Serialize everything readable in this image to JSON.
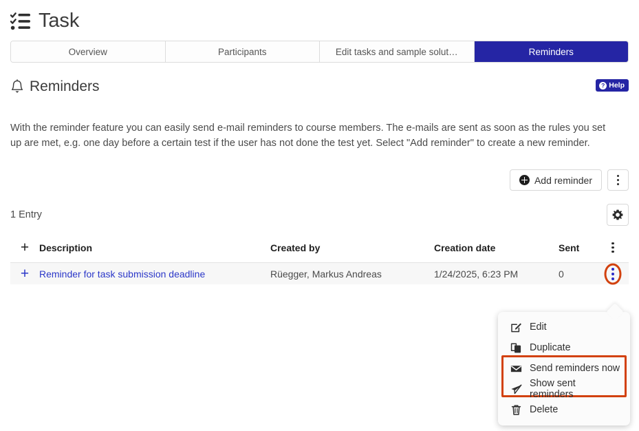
{
  "header": {
    "title": "Task",
    "icon": "checklist-icon"
  },
  "tabs": [
    {
      "label": "Overview",
      "active": false
    },
    {
      "label": "Participants",
      "active": false
    },
    {
      "label": "Edit tasks and sample solut…",
      "active": false
    },
    {
      "label": "Reminders",
      "active": true
    }
  ],
  "section": {
    "title": "Reminders",
    "icon": "bell-icon",
    "help_label": "Help",
    "help_icon": "question-circle-icon",
    "description": "With the reminder feature you can easily send e-mail reminders to course members. The e-mails are sent as soon as the rules you set up are met, e.g. one day before a certain test if the user has not done the test yet. Select \"Add reminder\" to create a new reminder."
  },
  "toolbar": {
    "add_label": "Add reminder",
    "add_icon": "plus-circle-icon",
    "more_icon": "kebab-menu-icon",
    "settings_icon": "gear-icon"
  },
  "list": {
    "entry_count": "1 Entry",
    "columns": {
      "expand": "+",
      "description": "Description",
      "created_by": "Created by",
      "creation_date": "Creation date",
      "sent": "Sent",
      "actions": "kebab-menu-icon"
    },
    "rows": [
      {
        "expand": "+",
        "description": "Reminder for task submission deadline",
        "created_by": "Rüegger, Markus Andreas",
        "creation_date": "1/24/2025, 6:23 PM",
        "sent": "0"
      }
    ]
  },
  "context_menu": {
    "items": [
      {
        "label": "Edit",
        "icon": "pencil-square-icon",
        "highlighted": false
      },
      {
        "label": "Duplicate",
        "icon": "copy-icon",
        "highlighted": false
      },
      {
        "label": "Send reminders now",
        "icon": "envelope-icon",
        "highlighted": true
      },
      {
        "label": "Show sent reminders",
        "icon": "paper-plane-icon",
        "highlighted": true
      },
      {
        "label": "Delete",
        "icon": "trash-icon",
        "highlighted": false
      }
    ]
  },
  "colors": {
    "accent_blue": "#2525a4",
    "link_blue": "#2b37c8",
    "highlight_orange": "#d2410e",
    "row_background": "#f7f7f7",
    "text": "#3b3b3b"
  }
}
